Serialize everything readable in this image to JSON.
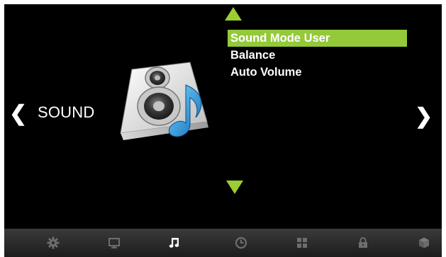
{
  "screen": {
    "category_label": "SOUND",
    "menu_items": [
      {
        "label": "Sound Mode User",
        "selected": true
      },
      {
        "label": "Balance",
        "selected": false
      },
      {
        "label": "Auto Volume",
        "selected": false
      }
    ],
    "accent_color": "#9bce32",
    "highlight_color": "#94c93a",
    "nav": {
      "left_glyph": "❮",
      "right_glyph": "❯"
    }
  },
  "bottom_bar": {
    "active_tab": "sound",
    "tabs": [
      {
        "icon": "gear-icon",
        "id": "setup"
      },
      {
        "icon": "monitor-icon",
        "id": "picture"
      },
      {
        "icon": "music-note-icon",
        "id": "sound"
      },
      {
        "icon": "clock-icon",
        "id": "time"
      },
      {
        "icon": "grid-icon",
        "id": "option"
      },
      {
        "icon": "lock-icon",
        "id": "lock"
      },
      {
        "icon": "cube-icon",
        "id": "usb"
      }
    ]
  }
}
